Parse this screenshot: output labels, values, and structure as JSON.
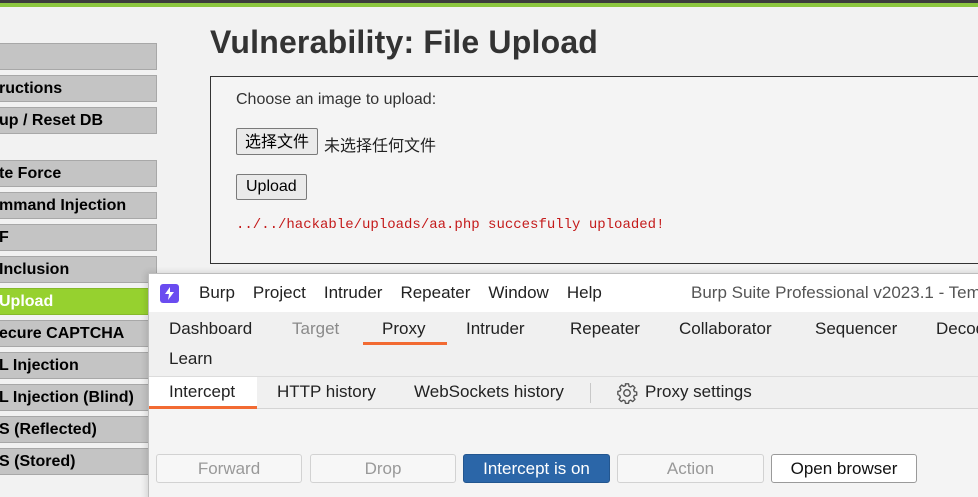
{
  "dvwa": {
    "menu": [
      {
        "label": ""
      },
      {
        "label": "ructions"
      },
      {
        "label": "up / Reset DB"
      },
      {
        "label": "te Force"
      },
      {
        "label": "mmand Injection"
      },
      {
        "label": "F"
      },
      {
        "label": "Inclusion"
      },
      {
        "label": "Upload"
      },
      {
        "label": "ecure CAPTCHA"
      },
      {
        "label": "L Injection"
      },
      {
        "label": "L Injection (Blind)"
      },
      {
        "label": "S (Reflected)"
      },
      {
        "label": "S (Stored)"
      }
    ],
    "page_title": "Vulnerability: File Upload",
    "upload_prompt": "Choose an image to upload:",
    "file_button": "选择文件",
    "file_status": "未选择任何文件",
    "upload_button": "Upload",
    "upload_message": "../../hackable/uploads/aa.php succesfully uploaded!"
  },
  "burp": {
    "menu": [
      "Burp",
      "Project",
      "Intruder",
      "Repeater",
      "Window",
      "Help"
    ],
    "app_title": "Burp Suite Professional v2023.1 - Tem",
    "tabs": {
      "dashboard": "Dashboard",
      "target": "Target",
      "proxy": "Proxy",
      "intruder": "Intruder",
      "repeater": "Repeater",
      "collaborator": "Collaborator",
      "sequencer": "Sequencer",
      "decoder": "Decod",
      "learn": "Learn"
    },
    "subtabs": {
      "intercept": "Intercept",
      "http_history": "HTTP history",
      "websockets_history": "WebSockets history",
      "proxy_settings": "Proxy settings"
    },
    "buttons": {
      "forward": "Forward",
      "drop": "Drop",
      "intercept": "Intercept is on",
      "action": "Action",
      "open_browser": "Open browser"
    },
    "colors": {
      "accent": "#f26a32",
      "primary": "#2b66a8",
      "logo": "#6a4cf0"
    }
  }
}
